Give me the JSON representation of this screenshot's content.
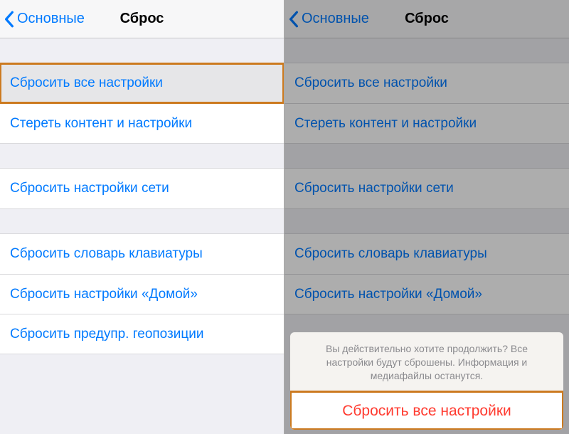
{
  "left": {
    "nav": {
      "back": "Основные",
      "title": "Сброс"
    },
    "group1": {
      "reset_all": "Сбросить все настройки",
      "erase_all": "Стереть контент и настройки"
    },
    "group2": {
      "reset_network": "Сбросить настройки сети"
    },
    "group3": {
      "reset_keyboard": "Сбросить словарь клавиатуры",
      "reset_home": "Сбросить настройки «Домой»",
      "reset_location": "Сбросить предупр. геопозиции"
    }
  },
  "right": {
    "nav": {
      "back": "Основные",
      "title": "Сброс"
    },
    "group1": {
      "reset_all": "Сбросить все настройки",
      "erase_all": "Стереть контент и настройки"
    },
    "group2": {
      "reset_network": "Сбросить настройки сети"
    },
    "group3": {
      "reset_keyboard": "Сбросить словарь клавиатуры",
      "reset_home": "Сбросить настройки «Домой»"
    },
    "sheet": {
      "message": "Вы действительно хотите продолжить? Все настройки будут сброшены. Информация и медиафайлы останутся.",
      "confirm": "Сбросить все настройки"
    }
  }
}
